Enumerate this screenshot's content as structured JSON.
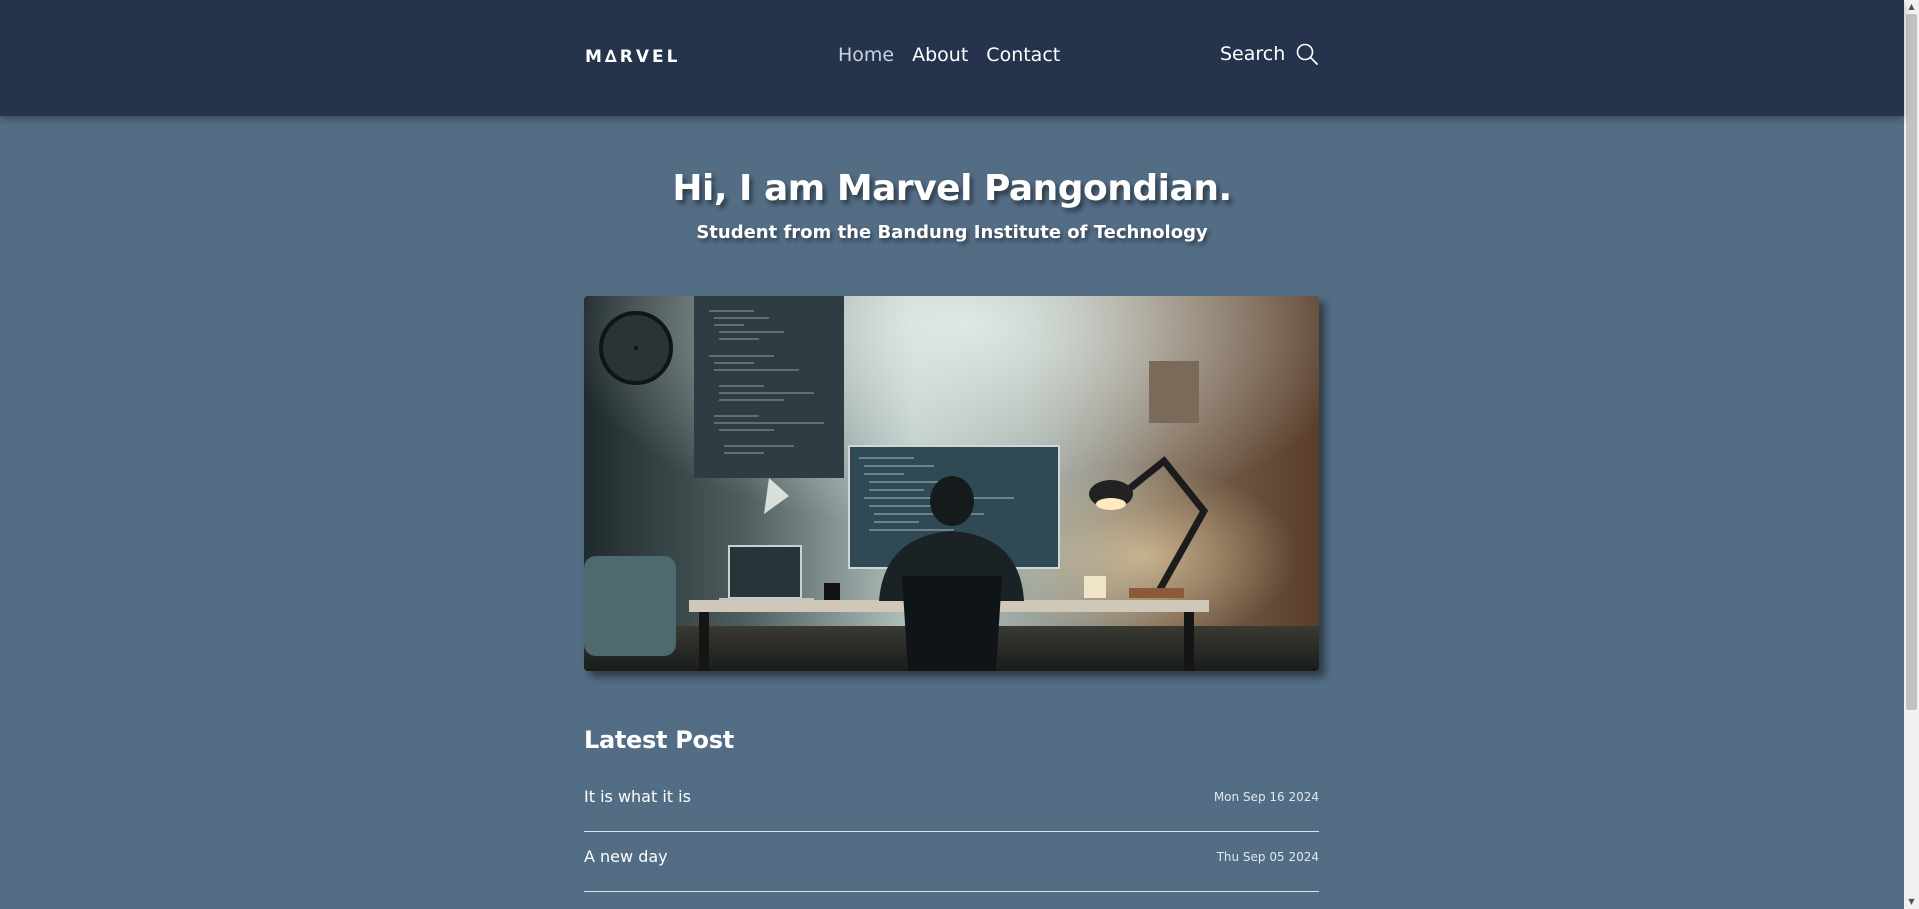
{
  "header": {
    "logo": "M∆RVEL",
    "nav": [
      {
        "label": "Home"
      },
      {
        "label": "About"
      },
      {
        "label": "Contact"
      }
    ],
    "search_label": "Search"
  },
  "hero": {
    "title": "Hi, I am Marvel Pangondian.",
    "subtitle": "Student from the Bandung Institute of Technology"
  },
  "latest": {
    "heading": "Latest Post",
    "posts": [
      {
        "title": "It is what it is",
        "date": "Mon Sep 16 2024"
      },
      {
        "title": "A new day",
        "date": "Thu Sep 05 2024"
      }
    ]
  },
  "colors": {
    "header_bg": "#25344c",
    "page_bg": "#536d85"
  },
  "icons": {
    "search": "search-icon"
  }
}
